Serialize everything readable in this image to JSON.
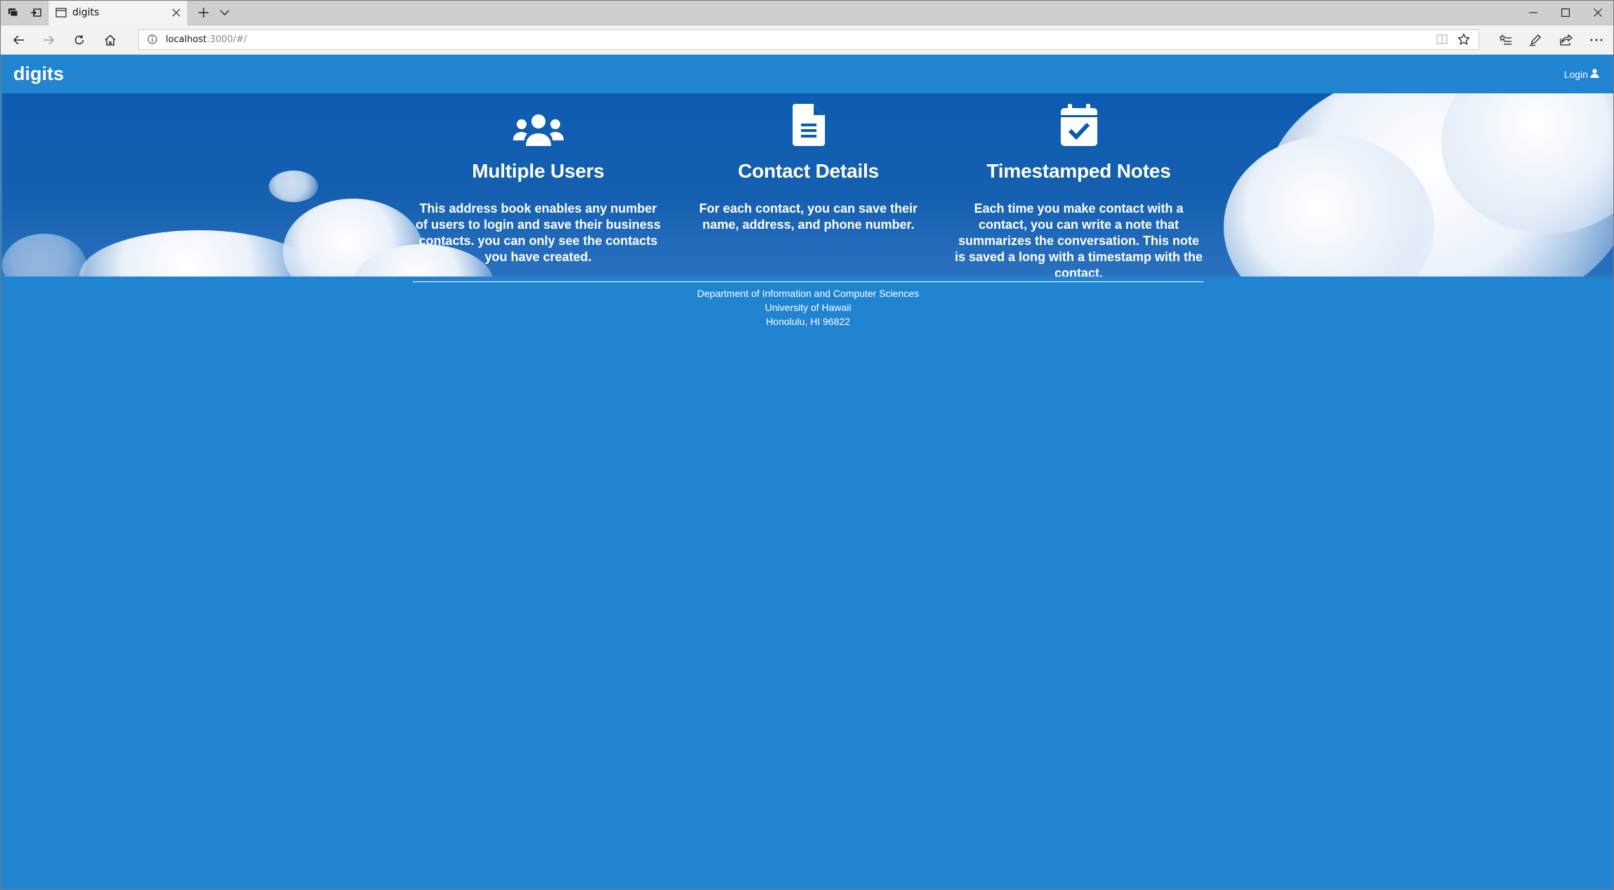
{
  "browser": {
    "tab_title": "digits",
    "url_host": "localhost",
    "url_path": ":3000/#/"
  },
  "app": {
    "brand": "digits",
    "login_label": "Login"
  },
  "features": [
    {
      "icon": "users-icon",
      "title": "Multiple Users",
      "text": "This address book enables any number of users to login and save their business contacts. you can only see the contacts you have created."
    },
    {
      "icon": "file-icon",
      "title": "Contact Details",
      "text": "For each contact, you can save their name, address, and phone number."
    },
    {
      "icon": "calendar-check-icon",
      "title": "Timestamped Notes",
      "text": "Each time you make contact with a contact, you can write a note that summarizes the conversation. This note is saved a long with a timestamp with the contact."
    }
  ],
  "footer": {
    "line1": "Department of Information and Computer Sciences",
    "line2": "University of Hawaii",
    "line3": "Honolulu, HI 96822"
  },
  "colors": {
    "page_background": "#2184d1",
    "hero_background": "#0d5cb2",
    "text": "#ffffff"
  }
}
